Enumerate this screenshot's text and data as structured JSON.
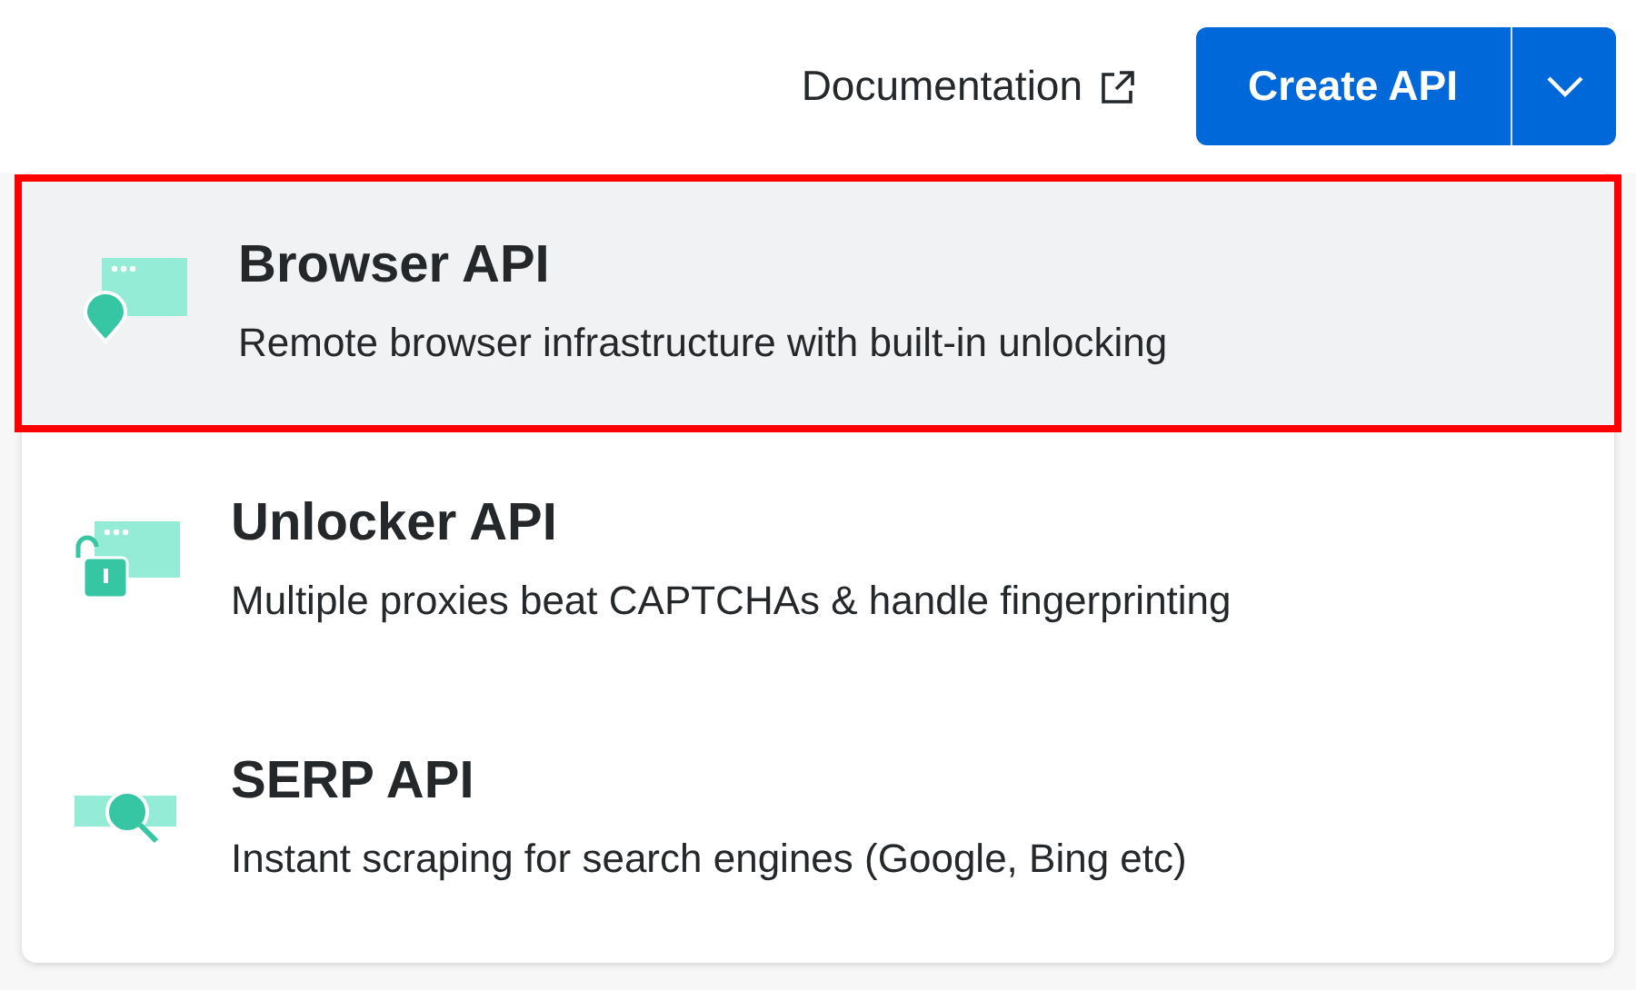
{
  "header": {
    "documentation_link": "Documentation",
    "create_button": "Create API"
  },
  "menu": [
    {
      "kind": "browser",
      "title": "Browser API",
      "description": "Remote browser infrastructure with built-in unlocking",
      "selected": true
    },
    {
      "kind": "unlocker",
      "title": "Unlocker API",
      "description": "Multiple proxies beat CAPTCHAs & handle fingerprinting",
      "selected": false
    },
    {
      "kind": "serp",
      "title": "SERP API",
      "description": "Instant scraping for search engines (Google, Bing etc)",
      "selected": false
    }
  ]
}
